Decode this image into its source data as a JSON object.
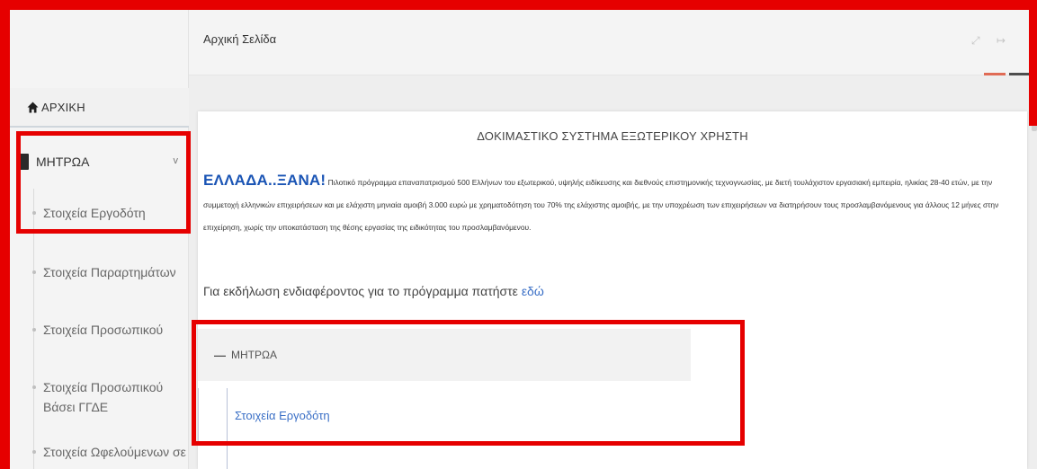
{
  "topbar": {
    "page_title": "Αρχική Σελίδα",
    "expand_icon": "expand-icon",
    "collapse_icon": "collapse-icon"
  },
  "sidebar": {
    "home_label": "ΑΡΧΙΚΗ",
    "mitroa_label": "ΜΗΤΡΩΑ",
    "items": [
      {
        "label": "Στοιχεία Εργοδότη"
      },
      {
        "label": "Στοιχεία Παραρτημάτων"
      },
      {
        "label": "Στοιχεία Προσωπικού"
      },
      {
        "label": "Στοιχεία Προσωπικού Βάσει ΓΓΔΕ"
      },
      {
        "label": "Στοιχεία Ωφελούμενων σε"
      }
    ]
  },
  "main": {
    "heading": "ΔΟΚΙΜΑΣΤΙΚΟ ΣΥΣΤΗΜΑ ΕΞΩΤΕΡΙΚΟΥ ΧΡΗΣΤΗ",
    "brand": "ΕΛΛΑΔΑ..ΞΑΝΑ!",
    "intro_text": "Πιλοτικό πρόγραμμα επαναπατρισμού 500 Ελλήνων του εξωτερικού, υψηλής ειδίκευσης και διεθνούς επιστημονικής τεχνογνωσίας, με διετή τουλάχιστον εργασιακή εμπειρία, ηλικίας 28-40 ετών, με την συμμετοχή ελληνικών επιχειρήσεων και με ελάχιστη μηνιαία αμοιβή 3.000 ευρώ με χρηματοδότηση του 70% της ελάχιστης αμοιβής, με την υποχρέωση των επιχειρήσεων να διατηρήσουν τους προσλαμβανόμενους για άλλους 12 μήνες στην επιχείρηση, χωρίς την υποκατάσταση της θέσης εργασίας της ειδικότητας του προσλαμβανόμενου.",
    "interest_text": "Για εκδήλωση ενδιαφέροντος για το πρόγραμμα πατήστε",
    "interest_link": "εδώ",
    "accordion_title": "ΜΗΤΡΩΑ",
    "accordion_item": "Στοιχεία Εργοδότη"
  },
  "colors": {
    "annotation": "#e60000",
    "link": "#3a6fc6",
    "brand": "#1b55b5",
    "accent_red": "#e06b55"
  }
}
